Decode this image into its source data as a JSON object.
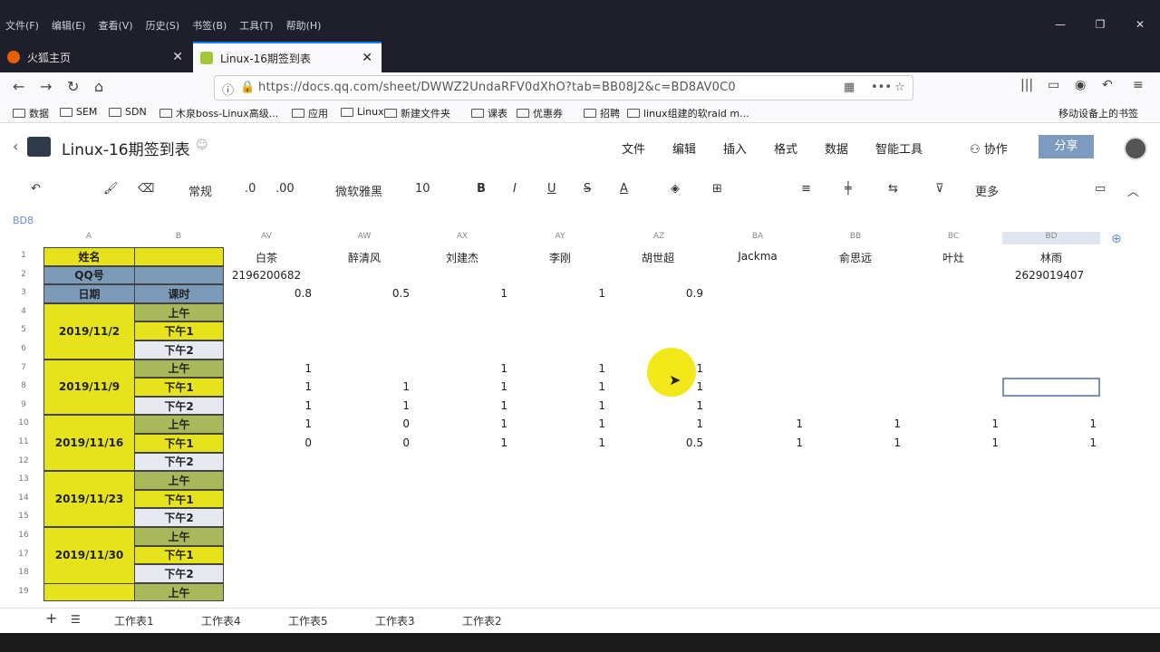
{
  "browser": {
    "menus": [
      "文件(F)",
      "编辑(E)",
      "查看(V)",
      "历史(S)",
      "书签(B)",
      "工具(T)",
      "帮助(H)"
    ],
    "tabs": [
      {
        "label": "火狐主页"
      },
      {
        "label": "Linux-16期签到表"
      }
    ],
    "url": "https://docs.qq.com/sheet/DWWZ2UndaRFV0dXhO?tab=BB08J2&c=BD8AV0C0",
    "bookmarks": [
      "数据",
      "SEM",
      "SDN",
      "木泉boss-Linux高级...",
      "应用",
      "Linux",
      "新建文件夹",
      "课表",
      "优惠券",
      "招聘",
      "linux组建的软raid m..."
    ],
    "mobile_bookmarks": "移动设备上的书签"
  },
  "doc": {
    "title": "Linux-16期签到表",
    "menu": [
      "文件",
      "编辑",
      "插入",
      "格式",
      "数据",
      "智能工具"
    ],
    "collab": "协作",
    "share": "分享"
  },
  "toolbar": {
    "format": "常规",
    "dec1": ".0",
    "dec2": ".00",
    "font": "微软雅黑",
    "size": "10",
    "more": "更多"
  },
  "cell_ref": "BD8",
  "columns": [
    "A",
    "B",
    "AV",
    "AW",
    "AX",
    "AY",
    "AZ",
    "BA",
    "BB",
    "BC",
    "BD"
  ],
  "row_numbers": [
    "1",
    "2",
    "3",
    "4",
    "5",
    "6",
    "7",
    "8",
    "9",
    "10",
    "11",
    "12",
    "13",
    "14",
    "15",
    "16",
    "17",
    "18",
    "19"
  ],
  "left": {
    "name_label": "姓名",
    "qq_label": "QQ号",
    "date_label": "日期",
    "session_label": "课时",
    "dates": [
      "2019/11/2",
      "2019/11/9",
      "2019/11/16",
      "2019/11/23",
      "2019/11/30"
    ],
    "sessions": [
      "上午",
      "下午1",
      "下午2"
    ]
  },
  "names": [
    "白茶",
    "醉清风",
    "刘建杰",
    "李刚",
    "胡世超",
    "Jackma",
    "俞思远",
    "叶灶",
    "林雨"
  ],
  "qq": {
    "AV": "2196200682",
    "BD": "2629019407"
  },
  "grid": {
    "r3": [
      "0.8",
      "0.5",
      "1",
      "1",
      "0.9",
      "",
      "",
      "",
      ""
    ],
    "r7": [
      "1",
      "",
      "1",
      "1",
      "1",
      "",
      "",
      "",
      ""
    ],
    "r8": [
      "1",
      "1",
      "1",
      "1",
      "1",
      "",
      "",
      "",
      ""
    ],
    "r9": [
      "1",
      "1",
      "1",
      "1",
      "1",
      "",
      "",
      "",
      ""
    ],
    "r10": [
      "1",
      "0",
      "1",
      "1",
      "1",
      "1",
      "1",
      "1",
      "1"
    ],
    "r11": [
      "0",
      "0",
      "1",
      "1",
      "0.5",
      "1",
      "1",
      "1",
      "1"
    ]
  },
  "sheets": [
    "工作表1",
    "工作表4",
    "工作表5",
    "工作表3",
    "工作表2"
  ]
}
